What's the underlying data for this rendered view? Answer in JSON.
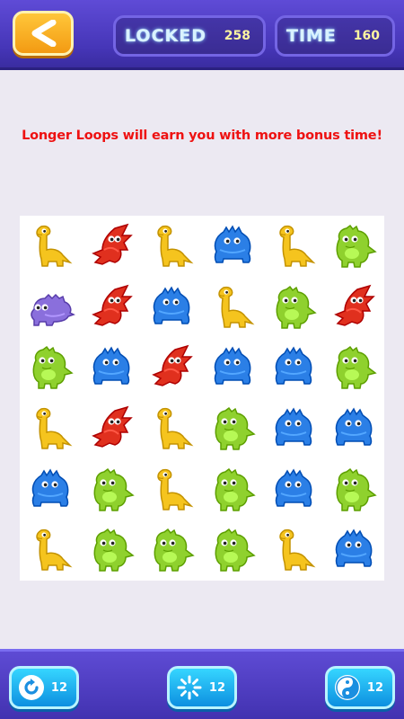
{
  "header": {
    "locked_label": "LOCKED",
    "locked_value": "258",
    "time_label": "TIME",
    "time_value": "160"
  },
  "hint": "Longer Loops will earn you with more bonus time!",
  "board": {
    "rows": 6,
    "cols": 6,
    "cells": [
      [
        "yellow-dino",
        "red-dragon",
        "yellow-dino",
        "blue-dino",
        "yellow-dino",
        "green-dino"
      ],
      [
        "purple-dino",
        "red-dragon",
        "blue-dino",
        "yellow-dino",
        "green-dino",
        "red-dragon"
      ],
      [
        "green-dino",
        "blue-dino",
        "red-dragon",
        "blue-dino",
        "blue-dino",
        "green-dino"
      ],
      [
        "yellow-dino",
        "red-dragon",
        "yellow-dino",
        "green-dino",
        "blue-dino",
        "blue-dino"
      ],
      [
        "blue-dino",
        "green-dino",
        "yellow-dino",
        "green-dino",
        "blue-dino",
        "green-dino"
      ],
      [
        "yellow-dino",
        "green-dino",
        "green-dino",
        "green-dino",
        "yellow-dino",
        "blue-dino"
      ]
    ]
  },
  "powerups": [
    {
      "icon": "refresh-icon",
      "count": "12"
    },
    {
      "icon": "freeze-icon",
      "count": "12"
    },
    {
      "icon": "yin-yang-icon",
      "count": "12"
    }
  ],
  "colors": {
    "yellow-dino": "#f5c41e",
    "red-dragon": "#e0301e",
    "blue-dino": "#2b7fe6",
    "green-dino": "#8fd12e",
    "purple-dino": "#8a6fdc",
    "hint_text": "#ee1111",
    "top_bar": "#4d3cc6",
    "back_button": "#f7a81e",
    "powerup_button": "#1fb4f2"
  }
}
